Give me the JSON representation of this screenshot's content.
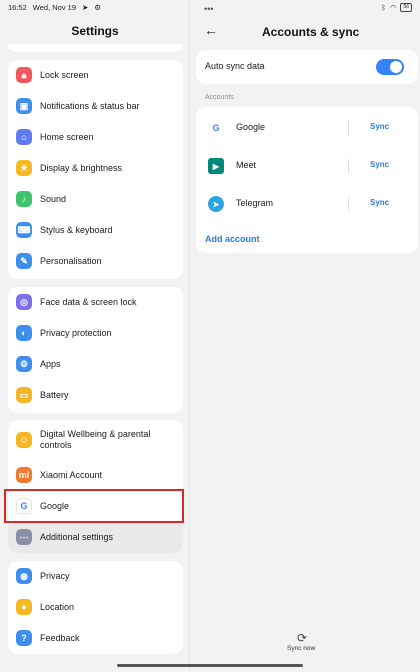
{
  "status": {
    "time": "16:52",
    "date": "Wed, Nov 19",
    "battery": "56"
  },
  "left": {
    "title": "Settings",
    "groups": [
      {
        "items": [
          {
            "label": "Lock screen",
            "icon": "lock-icon",
            "color": "#f0595b"
          },
          {
            "label": "Notifications & status bar",
            "icon": "notification-icon",
            "color": "#3e8ef0"
          },
          {
            "label": "Home screen",
            "icon": "home-icon",
            "color": "#5e7cf0"
          },
          {
            "label": "Display & brightness",
            "icon": "sun-icon",
            "color": "#f5b724"
          },
          {
            "label": "Sound",
            "icon": "speaker-icon",
            "color": "#3ec46d"
          },
          {
            "label": "Stylus & keyboard",
            "icon": "keyboard-icon",
            "color": "#3e8ef0"
          },
          {
            "label": "Personalisation",
            "icon": "brush-icon",
            "color": "#3e8ef0"
          }
        ]
      },
      {
        "items": [
          {
            "label": "Face data & screen lock",
            "icon": "fingerprint-icon",
            "color": "#7c6cf0"
          },
          {
            "label": "Privacy protection",
            "icon": "privacy-icon",
            "color": "#3e8ef0"
          },
          {
            "label": "Apps",
            "icon": "gear-icon",
            "color": "#3e8ef0"
          },
          {
            "label": "Battery",
            "icon": "battery-icon",
            "color": "#f5b724"
          }
        ]
      },
      {
        "items": [
          {
            "label": "Digital Wellbeing & parental controls",
            "icon": "wellbeing-icon",
            "color": "#f5b724"
          },
          {
            "label": "Xiaomi Account",
            "icon": "xiaomi-icon",
            "color": "#f07b2e"
          },
          {
            "label": "Google",
            "icon": "google-icon",
            "color": "#ffffff"
          },
          {
            "label": "Additional settings",
            "icon": "more-icon",
            "color": "#8a8fa3"
          }
        ]
      },
      {
        "items": [
          {
            "label": "Privacy",
            "icon": "eye-icon",
            "color": "#3e8ef0"
          },
          {
            "label": "Location",
            "icon": "location-icon",
            "color": "#f5b724"
          },
          {
            "label": "Feedback",
            "icon": "feedback-icon",
            "color": "#3e8ef0"
          }
        ]
      }
    ]
  },
  "right": {
    "title": "Accounts & sync",
    "auto_sync_label": "Auto sync data",
    "auto_sync_on": true,
    "section_label": "Accounts",
    "accounts": [
      {
        "name": "Google",
        "action": "Sync",
        "icon": "google-icon"
      },
      {
        "name": "Meet",
        "action": "Sync",
        "icon": "meet-icon"
      },
      {
        "name": "Telegram",
        "action": "Sync",
        "icon": "telegram-icon"
      }
    ],
    "add_account": "Add account",
    "sync_now": "Sync now"
  },
  "colors": {
    "accent": "#2a7de1",
    "toggle": "#3482f6",
    "highlight": "#d42a2a"
  }
}
